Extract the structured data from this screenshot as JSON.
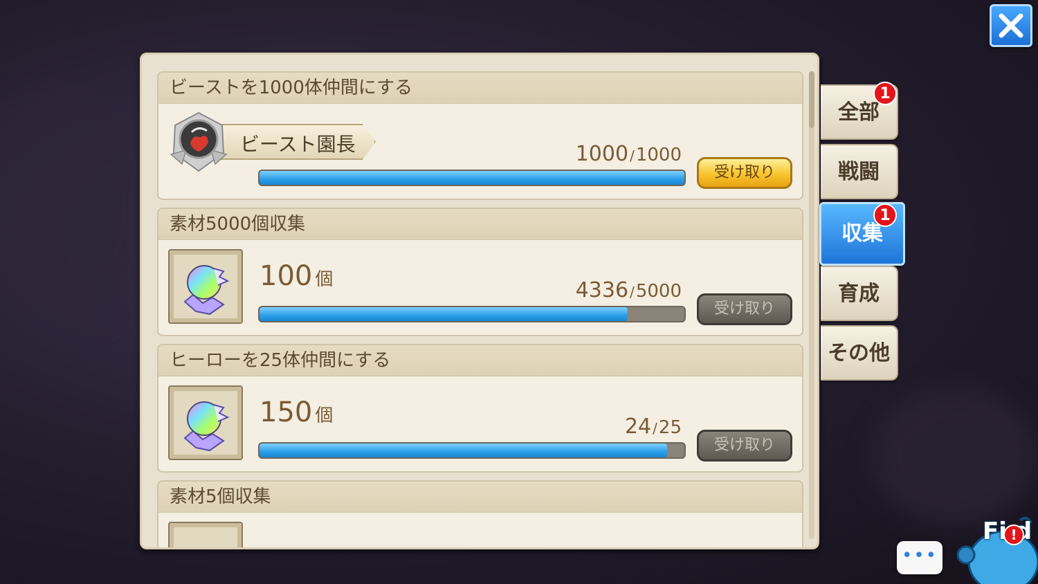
{
  "tabs": [
    {
      "label": "全部",
      "badge": "1",
      "active": false
    },
    {
      "label": "戦闘",
      "badge": "",
      "active": false
    },
    {
      "label": "収集",
      "badge": "1",
      "active": true
    },
    {
      "label": "育成",
      "badge": "",
      "active": false
    },
    {
      "label": "その他",
      "badge": "",
      "active": false
    }
  ],
  "missions": [
    {
      "title": "ビーストを1000体仲間にする",
      "reward_type": "title",
      "reward_title": "ビースト園長",
      "progress_current": "1000",
      "progress_sep": "/",
      "progress_max": "1000",
      "progress_fraction": 1.0,
      "claim_label": "受け取り",
      "claimable": true
    },
    {
      "title": "素材5000個収集",
      "reward_type": "item",
      "reward_amount": "100",
      "reward_unit": "個",
      "progress_current": "4336",
      "progress_sep": "/",
      "progress_max": "5000",
      "progress_fraction": 0.8672,
      "claim_label": "受け取り",
      "claimable": false
    },
    {
      "title": "ヒーローを25体仲間にする",
      "reward_type": "item",
      "reward_amount": "150",
      "reward_unit": "個",
      "progress_current": "24",
      "progress_sep": "/",
      "progress_max": "25",
      "progress_fraction": 0.96,
      "claim_label": "受け取り",
      "claimable": false
    },
    {
      "title": "素材5個収集"
    }
  ],
  "mascot": {
    "label": "Fi d",
    "alert": "!"
  },
  "chat": {
    "dots": "•••"
  },
  "colors": {
    "accent_blue": "#1f74d8",
    "badge_red": "#e3141a",
    "progress_blue": "#2a9ee8",
    "claim_gold": "#f7c42e"
  }
}
